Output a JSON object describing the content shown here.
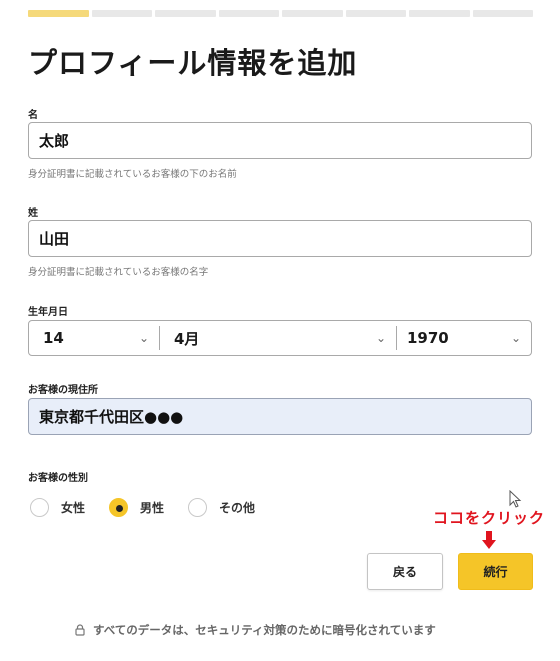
{
  "progress": {
    "total_steps": 8,
    "current_step": 1
  },
  "page_title": "プロフィール情報を追加",
  "first_name": {
    "label": "名",
    "value": "太郎",
    "hint": "身分証明書に記載されているお客様の下のお名前"
  },
  "last_name": {
    "label": "姓",
    "value": "山田",
    "hint": "身分証明書に記載されているお客様の名字"
  },
  "dob": {
    "label": "生年月日",
    "day": "14",
    "month": "4月",
    "year": "1970"
  },
  "address": {
    "label": "お客様の現住所",
    "value": "東京都千代田区●●●"
  },
  "gender": {
    "label": "お客様の性別",
    "options": [
      "女性",
      "男性",
      "その他"
    ],
    "selected": "男性"
  },
  "annotation": "ココをクリック",
  "buttons": {
    "back": "戻る",
    "next": "続行"
  },
  "footer": "すべてのデータは、セキュリティ対策のために暗号化されています",
  "colors": {
    "accent": "#f5c528",
    "progress_active": "#f5d97a",
    "annotation": "#e0141e",
    "address_fill": "#e8eef9"
  }
}
